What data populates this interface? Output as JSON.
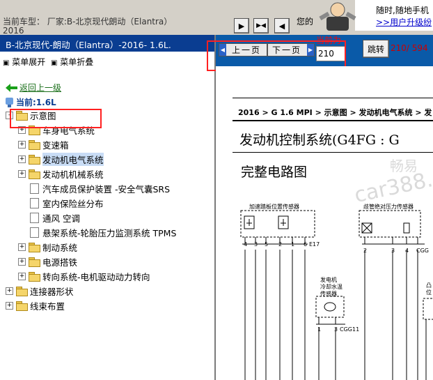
{
  "top": {
    "car_line1": "当前车型：  厂家:B-北京现代朗动（Elantra）",
    "car_line2": "2016",
    "your_text": "您的",
    "promo_line1": "随时,随地手机",
    "promo_line2": ">>用户升级纷"
  },
  "left_panel": {
    "header": "B-北京现代-朗动（Elantra）-2016- 1.6L.",
    "expand_label": "菜单展开",
    "collapse_label": "菜单折叠",
    "back_link": "返回上一级",
    "current_label": "当前:1.6L",
    "tree": [
      {
        "label": "示意图",
        "level": 1,
        "type": "folder",
        "toggle": "-"
      },
      {
        "label": "车身电气系统",
        "level": 2,
        "type": "folder",
        "toggle": "+"
      },
      {
        "label": "变速箱",
        "level": 2,
        "type": "folder",
        "toggle": "+"
      },
      {
        "label": "发动机电气系统",
        "level": 2,
        "type": "folder",
        "toggle": "+",
        "selected": true
      },
      {
        "label": "发动机机械系统",
        "level": 2,
        "type": "folder",
        "toggle": "+"
      },
      {
        "label": "汽车成员保护装置 -安全气囊SRS",
        "level": 2,
        "type": "doc"
      },
      {
        "label": "室内保险丝分布",
        "level": 2,
        "type": "doc"
      },
      {
        "label": "通风 空调",
        "level": 2,
        "type": "doc"
      },
      {
        "label": "悬架系统-轮胎压力监测系统 TPMS",
        "level": 2,
        "type": "doc"
      },
      {
        "label": "制动系统",
        "level": 2,
        "type": "folder",
        "toggle": "+"
      },
      {
        "label": "电源搭铁",
        "level": 2,
        "type": "folder",
        "toggle": "+"
      },
      {
        "label": "转向系统-电机驱动动力转向",
        "level": 2,
        "type": "folder",
        "toggle": "+"
      },
      {
        "label": "连接器形状",
        "level": 1,
        "type": "folder",
        "toggle": "+"
      },
      {
        "label": "线束布置",
        "level": 1,
        "type": "folder",
        "toggle": "+"
      }
    ]
  },
  "toolbar": {
    "current_label": "当前为",
    "prev_label": "上一页",
    "next_label": "下一页",
    "page_value": "210",
    "jump_label": "跳转",
    "page_count": "210/ 594"
  },
  "diagram": {
    "breadcrumb": "2016 > G 1.6 MPI > 示意图 > 发动机电气系统 > 发",
    "title": "发动机控制系统(G4FG : G",
    "subtitle": "完整电路图",
    "sensor1_label": "加速踏板位置传感器",
    "sensor2_label": "歧管绝对压力传感器",
    "sensor3_label_1": "发电机",
    "sensor3_label_2": "冷却水温",
    "sensor3_label_3": "传感器",
    "sensor4_label_1": "凸",
    "sensor4_label_2": "位",
    "pin_labels_1": [
      "4",
      "3",
      "5",
      "2",
      "1",
      "6",
      "E17"
    ],
    "pin_labels_2": [
      "2",
      "3",
      "4",
      "CGG"
    ],
    "pin_labels_3": [
      "1",
      "3",
      "CGG11"
    ],
    "watermark_1": "畅易",
    "watermark_2": "car388.co"
  }
}
